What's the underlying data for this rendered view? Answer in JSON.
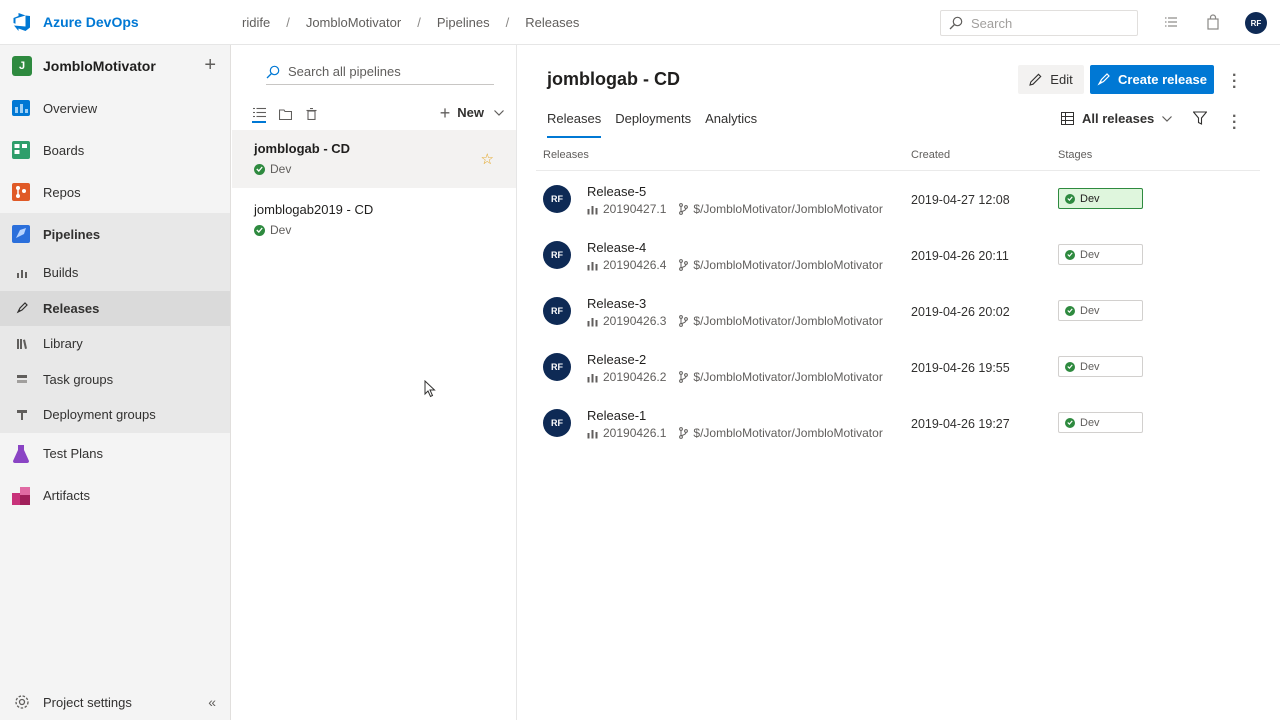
{
  "brand": {
    "name": "Azure DevOps"
  },
  "breadcrumbs": [
    "ridife",
    "JombloMotivator",
    "Pipelines",
    "Releases"
  ],
  "search": {
    "placeholder": "Search"
  },
  "user": {
    "initials": "RF"
  },
  "project": {
    "badge": "J",
    "name": "JombloMotivator"
  },
  "nav": {
    "items": [
      {
        "label": "Overview",
        "color": "#0078d4"
      },
      {
        "label": "Boards",
        "color": "#2e9e6b"
      },
      {
        "label": "Repos",
        "color": "#e05a27"
      },
      {
        "label": "Pipelines",
        "color": "#2b6fdb"
      }
    ],
    "sub_items": [
      {
        "label": "Builds"
      },
      {
        "label": "Releases"
      },
      {
        "label": "Library"
      },
      {
        "label": "Task groups"
      },
      {
        "label": "Deployment groups"
      }
    ],
    "bottom_items": [
      {
        "label": "Test Plans",
        "color": "#8a44c4"
      },
      {
        "label": "Artifacts",
        "color": "#c8327a"
      }
    ],
    "project_settings": "Project settings"
  },
  "pipelines_pane": {
    "search_placeholder": "Search all pipelines",
    "new_label": "New",
    "items": [
      {
        "name": "jomblogab - CD",
        "env": "Dev"
      },
      {
        "name": "jomblogab2019 - CD",
        "env": "Dev"
      }
    ]
  },
  "main": {
    "title": "jomblogab - CD",
    "edit_label": "Edit",
    "create_label": "Create release",
    "tabs": [
      "Releases",
      "Deployments",
      "Analytics"
    ],
    "filter_label": "All releases",
    "columns": {
      "releases": "Releases",
      "created": "Created",
      "stages": "Stages"
    },
    "releases": [
      {
        "initials": "RF",
        "name": "Release-5",
        "build": "20190427.1",
        "branch": "$/JombloMotivator/JombloMotivator",
        "created": "2019-04-27 12:08",
        "stage": "Dev"
      },
      {
        "initials": "RF",
        "name": "Release-4",
        "build": "20190426.4",
        "branch": "$/JombloMotivator/JombloMotivator",
        "created": "2019-04-26 20:11",
        "stage": "Dev"
      },
      {
        "initials": "RF",
        "name": "Release-3",
        "build": "20190426.3",
        "branch": "$/JombloMotivator/JombloMotivator",
        "created": "2019-04-26 20:02",
        "stage": "Dev"
      },
      {
        "initials": "RF",
        "name": "Release-2",
        "build": "20190426.2",
        "branch": "$/JombloMotivator/JombloMotivator",
        "created": "2019-04-26 19:55",
        "stage": "Dev"
      },
      {
        "initials": "RF",
        "name": "Release-1",
        "build": "20190426.1",
        "branch": "$/JombloMotivator/JombloMotivator",
        "created": "2019-04-26 19:27",
        "stage": "Dev"
      }
    ]
  }
}
